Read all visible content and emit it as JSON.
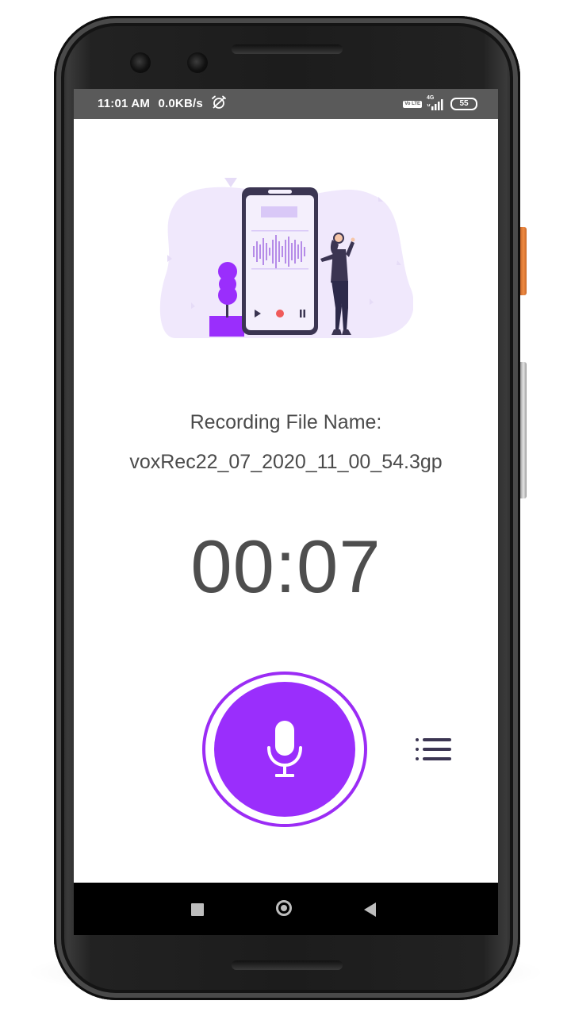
{
  "status_bar": {
    "time": "11:01 AM",
    "speed": "0.0KB/s",
    "icons": [
      "alarm-off-icon",
      "volte-icon",
      "signal-4g-icon"
    ],
    "network": "4G",
    "volte_label": "Vo LTE",
    "battery": "55"
  },
  "recording": {
    "label": "Recording File Name:",
    "file_name": "voxRec22_07_2020_11_00_54.3gp",
    "timer": "00:07"
  },
  "controls": {
    "record_icon": "microphone-icon",
    "list_icon": "list-icon"
  },
  "nav_bar": {
    "icons": [
      "recents-square-icon",
      "home-circle-icon",
      "back-triangle-icon"
    ]
  },
  "colors": {
    "accent": "#9a2efc",
    "accent_ring": "#9b2cf5",
    "text": "#4b4b4b",
    "status_bar": "#5a5a5a",
    "nav_bar": "#000000",
    "illustration_bg": "#f0e8fc"
  }
}
